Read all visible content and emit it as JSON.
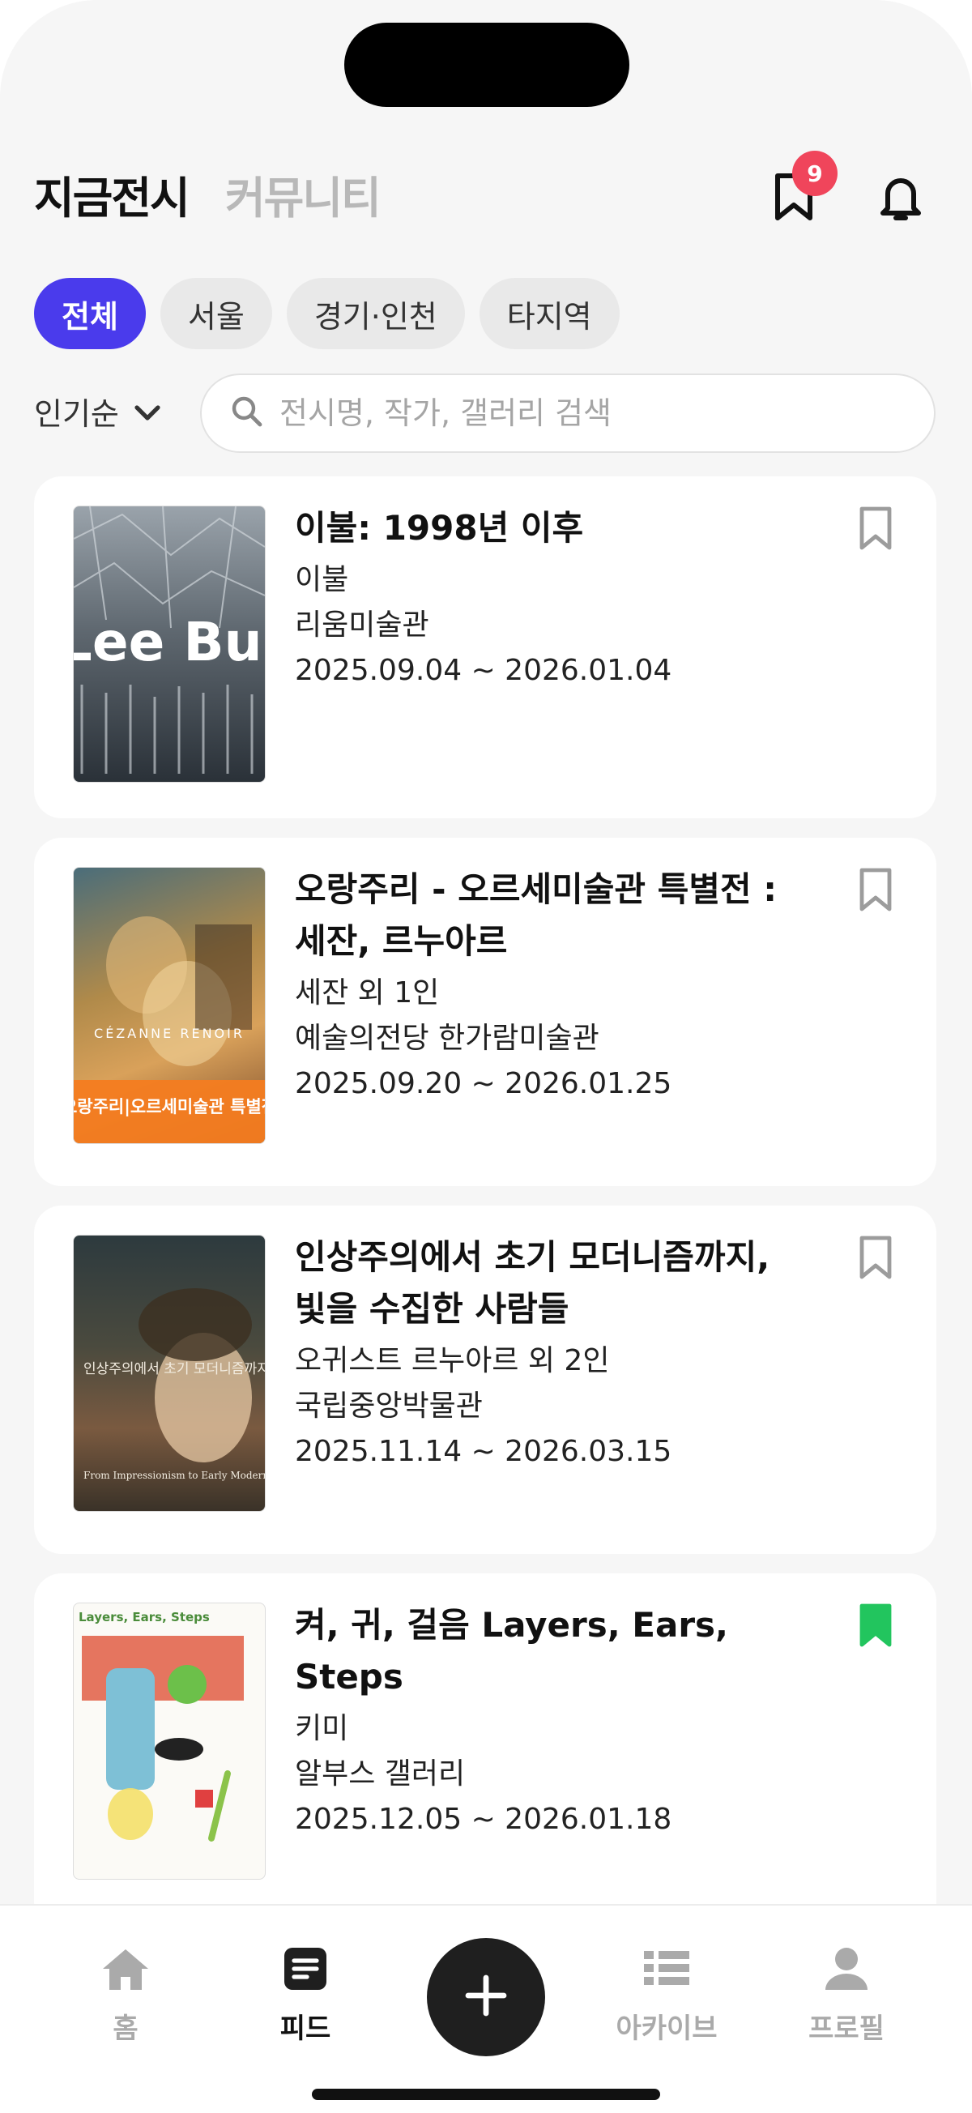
{
  "header": {
    "tab_active": "지금전시",
    "tab_inactive": "커뮤니티",
    "bookmark_badge": "9",
    "bookmark_icon": "bookmark-outline-icon",
    "bell_icon": "bell-icon"
  },
  "regions": [
    "전체",
    "서울",
    "경기·인천",
    "타지역"
  ],
  "sort": {
    "label": "인기순",
    "icon": "chevron-down-icon"
  },
  "search": {
    "placeholder": "전시명, 작가, 갤러리 검색",
    "value": ""
  },
  "exhibitions": [
    {
      "title": "이불: 1998년 이후",
      "artist": "이불",
      "venue": "리움미술관",
      "dates": "2025.09.04 ~ 2026.01.04",
      "bookmarked": false,
      "poster_text": "Lee Bul"
    },
    {
      "title": "오랑주리 - 오르세미술관 특별전 : 세잔, 르누아르",
      "artist": "세잔 외 1인",
      "venue": "예술의전당 한가람미술관",
      "dates": "2025.09.20 ~ 2026.01.25",
      "bookmarked": false,
      "poster_text": "CÉZANNE RENOIR",
      "poster_sub": "오랑주리|오르세미술관 특별전"
    },
    {
      "title": "인상주의에서 초기 모더니즘까지, 빛을 수집한 사람들",
      "artist": "오귀스트 르누아르 외 2인",
      "venue": "국립중앙박물관",
      "dates": "2025.11.14 ~ 2026.03.15",
      "bookmarked": false,
      "poster_text": "인상주의에서 초기 모더니즘까지",
      "poster_sub": "From Impressionism to Early Modernism"
    },
    {
      "title": "켜, 귀, 걸음 Layers, Ears, Steps",
      "artist": "키미",
      "venue": "알부스 갤러리",
      "dates": "2025.12.05 ~ 2026.01.18",
      "bookmarked": true,
      "poster_text": "Layers, Ears, Steps"
    }
  ],
  "bottom_nav": [
    {
      "label": "홈",
      "icon": "home-icon",
      "active": false
    },
    {
      "label": "피드",
      "icon": "feed-icon",
      "active": true
    },
    {
      "label": "",
      "icon": "plus-icon",
      "active": false
    },
    {
      "label": "아카이브",
      "icon": "list-icon",
      "active": false
    },
    {
      "label": "프로필",
      "icon": "person-icon",
      "active": false
    }
  ],
  "colors": {
    "accent": "#4a3bec",
    "badge": "#f0455b",
    "bookmark_active": "#22c55e",
    "background": "#f6f6f6"
  }
}
